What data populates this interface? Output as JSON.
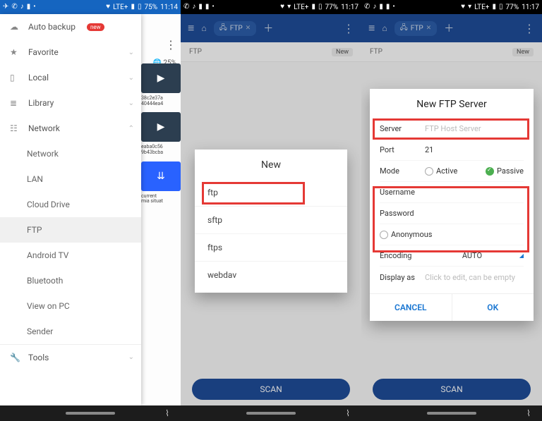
{
  "statusbar": {
    "p1_time": "11:14",
    "p1_batt": "75%",
    "p23_time": "11:17",
    "p23_batt": "77%",
    "net": "LTE+"
  },
  "drawer": {
    "auto_backup": "Auto backup",
    "new_badge": "new",
    "favorite": "Favorite",
    "local": "Local",
    "library": "Library",
    "network": "Network",
    "tools": "Tools",
    "subs": {
      "network": "Network",
      "lan": "LAN",
      "cloud": "Cloud Drive",
      "ftp": "FTP",
      "androidtv": "Android TV",
      "bluetooth": "Bluetooth",
      "viewonpc": "View on PC",
      "sender": "Sender"
    }
  },
  "behind1": {
    "storage": "25%",
    "f1a": "38c2e37a",
    "f1b": "40444ea4",
    "f2a": "eaba0c56",
    "f2b": "9b43bcba",
    "f3a": "current",
    "f3b": "mia situat"
  },
  "appchip": {
    "label": "FTP"
  },
  "locrow": {
    "path": "FTP",
    "new": "New"
  },
  "scan": "SCAN",
  "dlg2": {
    "title": "New",
    "ftp": "ftp",
    "sftp": "sftp",
    "ftps": "ftps",
    "webdav": "webdav"
  },
  "dlg3": {
    "title": "New FTP Server",
    "server_lab": "Server",
    "server_ph": "FTP Host Server",
    "port_lab": "Port",
    "port_val": "21",
    "mode_lab": "Mode",
    "active": "Active",
    "passive": "Passive",
    "user_lab": "Username",
    "pass_lab": "Password",
    "anon": "Anonymous",
    "enc_lab": "Encoding",
    "enc_val": "AUTO",
    "disp_lab": "Display as",
    "disp_ph": "Click to edit, can be empty",
    "cancel": "CANCEL",
    "ok": "OK"
  }
}
